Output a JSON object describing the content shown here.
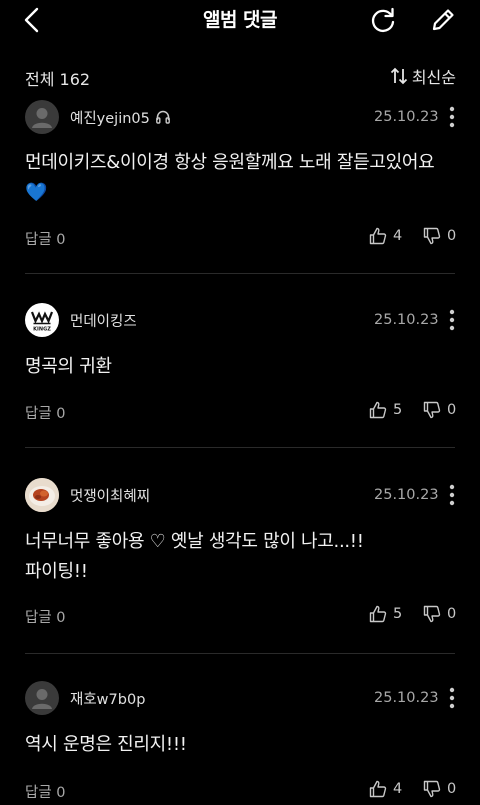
{
  "header": {
    "title": "앨범 댓글",
    "back_icon": "chevron-left-icon",
    "refresh_icon": "refresh-icon",
    "edit_icon": "pencil-icon"
  },
  "subheader": {
    "total_label": "전체 162",
    "sort_label": "최신순",
    "sort_icon": "sort-arrows-icon"
  },
  "colors": {
    "background": "#000000",
    "text": "#f2f2f2",
    "muted": "#a8a8a8",
    "divider": "#2a2a2a"
  },
  "comments": [
    {
      "username": "예진yejin05",
      "has_headphone_badge": true,
      "avatar": "default-user-icon",
      "date": "25.10.23",
      "text": "먼데이키즈&이이경 항상 응원할께요 노래 잘듣고있어요\n💙",
      "reply_label": "답글 0",
      "likes": "4",
      "dislikes": "0"
    },
    {
      "username": "먼데이킹즈",
      "has_headphone_badge": false,
      "avatar": "kingz-logo",
      "date": "25.10.23",
      "text": "명곡의 귀환",
      "reply_label": "답글 0",
      "likes": "5",
      "dislikes": "0"
    },
    {
      "username": "멋쟁이최혜찌",
      "has_headphone_badge": false,
      "avatar": "food-photo",
      "date": "25.10.23",
      "text": "너무너무 좋아용 ♡ 옛날 생각도 많이 나고...!!\n파이팅!!",
      "reply_label": "답글 0",
      "likes": "5",
      "dislikes": "0"
    },
    {
      "username": "재호w7b0p",
      "has_headphone_badge": false,
      "avatar": "default-user-icon",
      "date": "25.10.23",
      "text": "역시 운명은 진리지!!!",
      "reply_label": "답글 0",
      "likes": "4",
      "dislikes": "0"
    }
  ]
}
